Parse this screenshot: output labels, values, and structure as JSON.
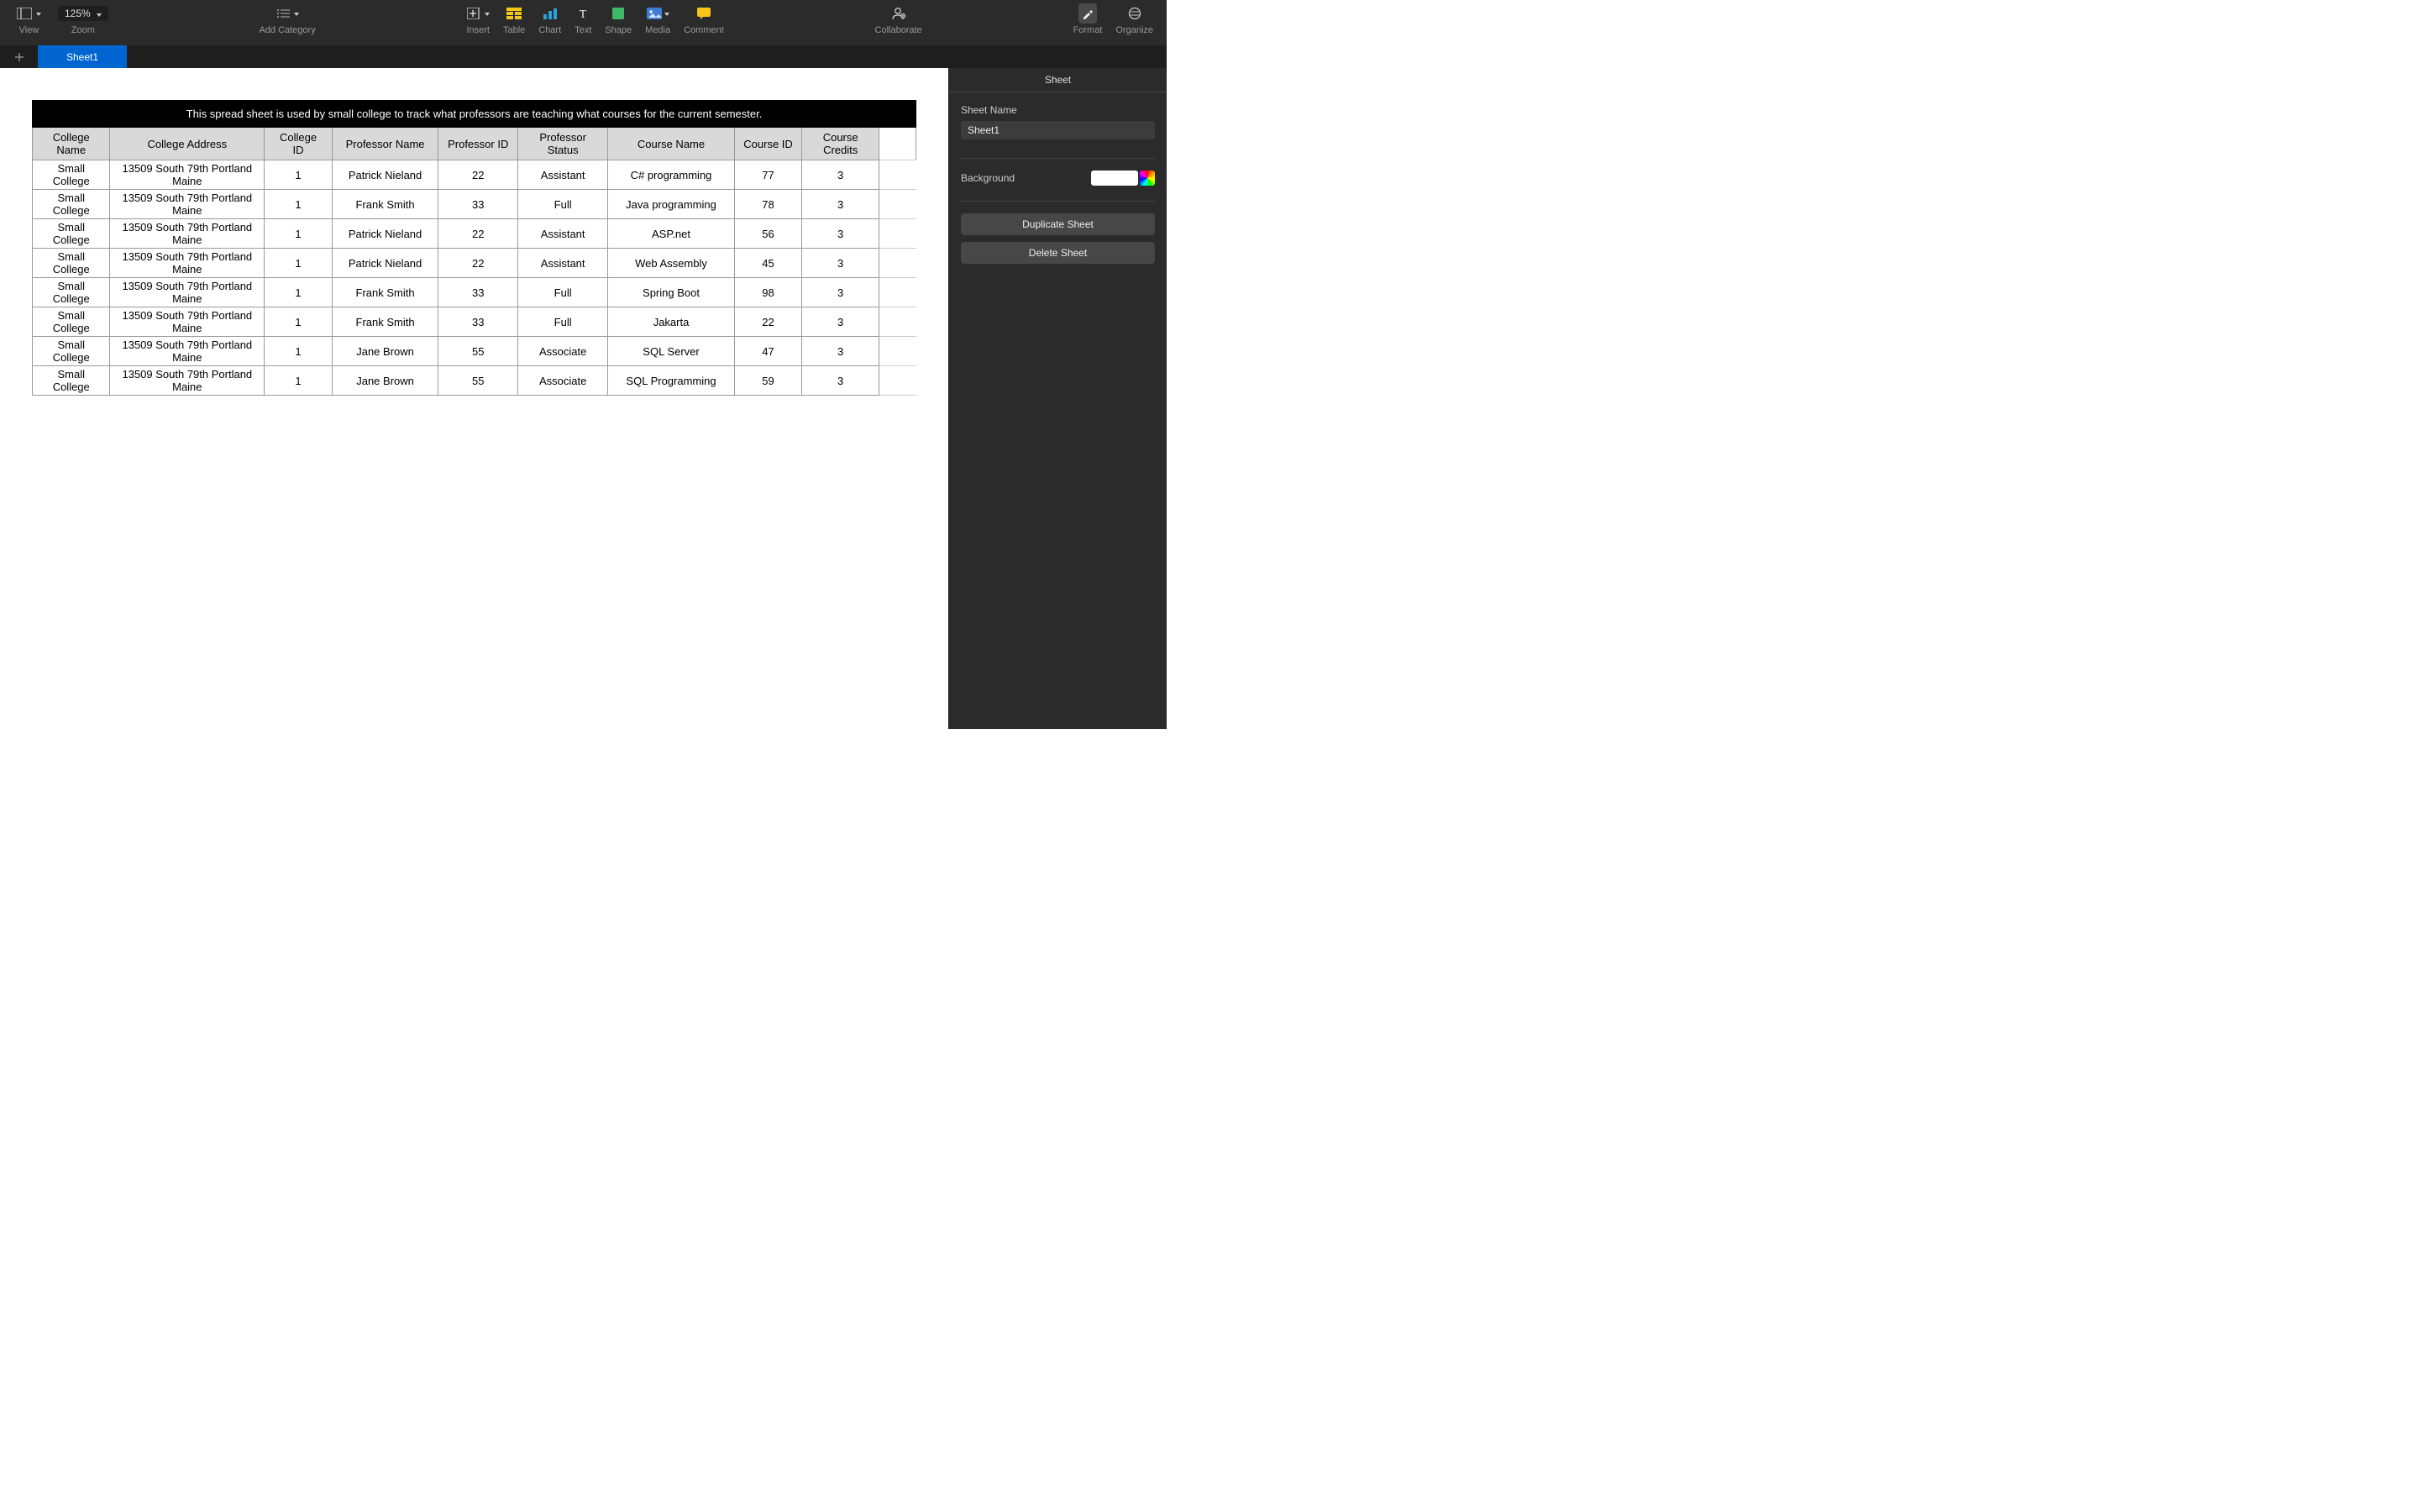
{
  "toolbar": {
    "view_label": "View",
    "zoom_label": "Zoom",
    "zoom_value": "125%",
    "add_category_label": "Add Category",
    "insert_label": "Insert",
    "table_label": "Table",
    "chart_label": "Chart",
    "text_label": "Text",
    "shape_label": "Shape",
    "media_label": "Media",
    "comment_label": "Comment",
    "collaborate_label": "Collaborate",
    "format_label": "Format",
    "organize_label": "Organize"
  },
  "tabs": {
    "sheet1": "Sheet1"
  },
  "table": {
    "title": "This spread sheet is used by small college to track what professors are teaching what courses for the current semester.",
    "headers": [
      "College Name",
      "College Address",
      "College ID",
      "Professor Name",
      "Professor ID",
      "Professor Status",
      "Course Name",
      "Course ID",
      "Course Credits"
    ],
    "rows": [
      [
        "Small College",
        "13509 South 79th Portland Maine",
        "1",
        "Patrick Nieland",
        "22",
        "Assistant",
        "C# programming",
        "77",
        "3"
      ],
      [
        "Small College",
        "13509 South 79th Portland Maine",
        "1",
        "Frank Smith",
        "33",
        "Full",
        "Java programming",
        "78",
        "3"
      ],
      [
        "Small College",
        "13509 South 79th Portland Maine",
        "1",
        "Patrick Nieland",
        "22",
        "Assistant",
        "ASP.net",
        "56",
        "3"
      ],
      [
        "Small College",
        "13509 South 79th Portland Maine",
        "1",
        "Patrick Nieland",
        "22",
        "Assistant",
        "Web Assembly",
        "45",
        "3"
      ],
      [
        "Small College",
        "13509 South 79th Portland Maine",
        "1",
        "Frank Smith",
        "33",
        "Full",
        "Spring Boot",
        "98",
        "3"
      ],
      [
        "Small College",
        "13509 South 79th Portland Maine",
        "1",
        "Frank Smith",
        "33",
        "Full",
        "Jakarta",
        "22",
        "3"
      ],
      [
        "Small College",
        "13509 South 79th Portland Maine",
        "1",
        "Jane Brown",
        "55",
        "Associate",
        "SQL Server",
        "47",
        "3"
      ],
      [
        "Small College",
        "13509 South 79th Portland Maine",
        "1",
        "Jane Brown",
        "55",
        "Associate",
        "SQL Programming",
        "59",
        "3"
      ]
    ]
  },
  "inspector": {
    "tab_label": "Sheet",
    "sheet_name_label": "Sheet Name",
    "sheet_name_value": "Sheet1",
    "background_label": "Background",
    "duplicate_label": "Duplicate Sheet",
    "delete_label": "Delete Sheet"
  }
}
